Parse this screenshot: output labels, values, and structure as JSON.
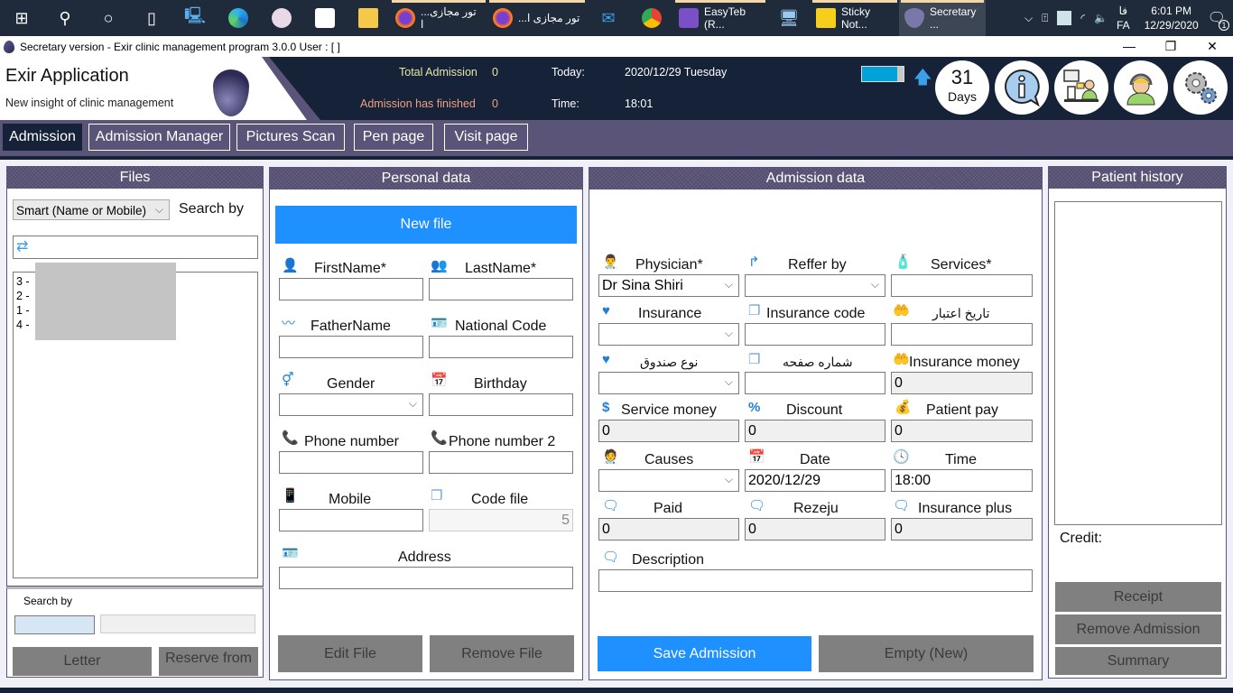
{
  "taskbar": {
    "apps": [
      {
        "label": "...تور مجازی ا",
        "icon": "firefox-icon"
      },
      {
        "label": "...تور مجازی ا",
        "icon": "firefox-icon"
      },
      {
        "label": "EasyTeb (R...",
        "icon": "visual-studio-icon"
      },
      {
        "label": "Sticky Not...",
        "icon": "sticky-notes-icon"
      },
      {
        "label": "Secretary ...",
        "icon": "exir-app-icon"
      }
    ],
    "lang_top": "فا",
    "lang_bottom": "FA",
    "time": "6:01 PM",
    "date": "12/29/2020",
    "notification_count": "1"
  },
  "window": {
    "title": "Secretary version - Exir clinic management program 3.0.0 User : [ ]",
    "minimize": "—",
    "maximize": "❐",
    "close": "✕"
  },
  "header": {
    "app_title": "Exir Application",
    "app_subtitle": "New insight of clinic management",
    "total_admission_label": "Total Admission",
    "total_admission_value": "0",
    "finished_label": "Admission has finished",
    "finished_value": "0",
    "today_label": "Today:",
    "today_value": "2020/12/29  Tuesday",
    "time_label": "Time:",
    "time_value": "18:01",
    "days_number": "31",
    "days_label": "Days",
    "battery_level": 0.85,
    "colors": {
      "header_bg": "#152238",
      "accent": "#5a5478",
      "total_label": "#e8e4a8",
      "finished_label": "#f0a080"
    }
  },
  "nav": {
    "tabs": [
      {
        "label": "Admission",
        "active": true
      },
      {
        "label": "Admission Manager",
        "active": false
      },
      {
        "label": "Pictures  Scan",
        "active": false
      },
      {
        "label": "Pen page",
        "active": false
      },
      {
        "label": "Visit page",
        "active": false
      }
    ]
  },
  "files": {
    "title": "Files",
    "search_mode": "Smart (Name or Mobile)",
    "search_by_label": "Search by",
    "search_value": "",
    "list": [
      "3 -",
      "2 -",
      "1 -",
      "4 -"
    ],
    "bottom_search_label": "Search by",
    "letter_button": "Letter",
    "reserve_button": "Reserve from"
  },
  "personal": {
    "title": "Personal data",
    "new_file_button": "New file",
    "first_name_label": "FirstName*",
    "last_name_label": "LastName*",
    "father_name_label": "FatherName",
    "national_code_label": "National Code",
    "gender_label": "Gender",
    "birthday_label": "Birthday",
    "phone_label": "Phone number",
    "phone2_label": "Phone number 2",
    "mobile_label": "Mobile",
    "code_file_label": "Code file",
    "code_file_value": "5",
    "address_label": "Address",
    "edit_button": "Edit File",
    "remove_button": "Remove File"
  },
  "admission": {
    "title": "Admission data",
    "physician_label": "Physician*",
    "physician_value": "Dr Sina Shiri",
    "reffer_label": "Reffer by",
    "services_label": "Services*",
    "insurance_label": "Insurance",
    "insurance_code_label": "Insurance code",
    "validity_date_label": "تاریخ اعتبار",
    "fund_type_label": "نوع صندوق",
    "page_number_label": "شماره صفحه",
    "insurance_money_label": "Insurance money",
    "insurance_money_value": "0",
    "service_money_label": "Service money",
    "service_money_value": "0",
    "discount_label": "Discount",
    "discount_value": "0",
    "patient_pay_label": "Patient pay",
    "patient_pay_value": "0",
    "causes_label": "Causes",
    "date_label": "Date",
    "date_value": "2020/12/29",
    "time_label": "Time",
    "time_value": "18:00",
    "paid_label": "Paid",
    "paid_value": "0",
    "rezeju_label": "Rezeju",
    "rezeju_value": "0",
    "insurance_plus_label": "Insurance plus",
    "insurance_plus_value": "0",
    "description_label": "Description",
    "save_button": "Save Admission",
    "empty_button": "Empty (New)"
  },
  "history": {
    "title": "Patient history",
    "credit_label": "Credit:",
    "receipt_button": "Receipt",
    "remove_admission_button": "Remove Admission",
    "summary_button": "Summary"
  }
}
